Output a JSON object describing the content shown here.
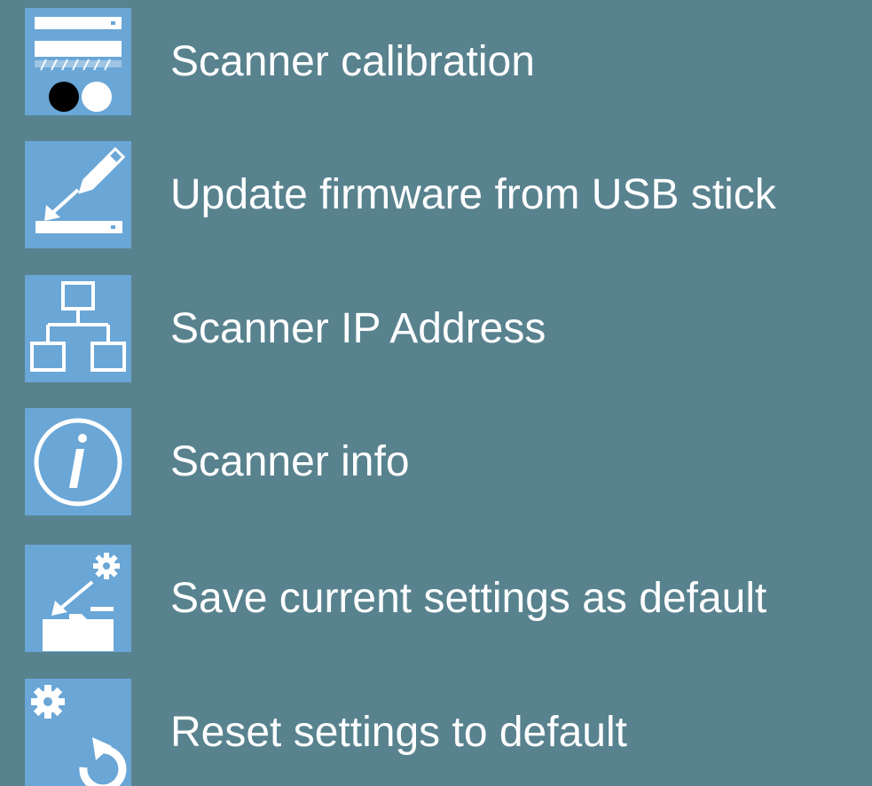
{
  "menu": {
    "items": [
      {
        "label": "Scanner calibration",
        "icon": "scanner-calibration-icon"
      },
      {
        "label": "Update firmware from USB stick",
        "icon": "firmware-update-icon"
      },
      {
        "label": "Scanner IP Address",
        "icon": "network-icon"
      },
      {
        "label": "Scanner info",
        "icon": "info-icon"
      },
      {
        "label": "Save current settings as default",
        "icon": "save-settings-icon"
      },
      {
        "label": "Reset settings to default",
        "icon": "reset-settings-icon"
      }
    ]
  },
  "colors": {
    "background": "#58828e",
    "tile": "#6aa6d6",
    "text": "#ffffff"
  }
}
